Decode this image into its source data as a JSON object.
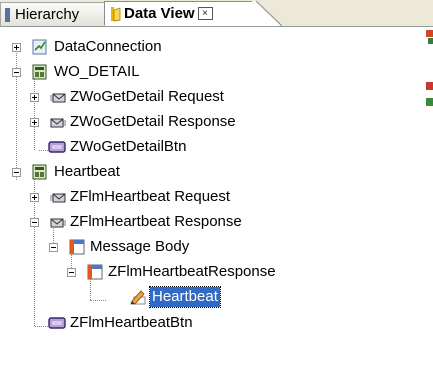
{
  "tabs": [
    {
      "label": "Hierarchy",
      "active": false
    },
    {
      "label": "Data View",
      "active": true
    }
  ],
  "tree": {
    "nodes": [
      {
        "label": "DataConnection",
        "icon": "data-connection-icon",
        "expander": "plus"
      },
      {
        "label": "WO_DETAIL",
        "icon": "service-icon",
        "expander": "minus"
      },
      {
        "label": "ZWoGetDetail Request",
        "icon": "request-envelope-icon",
        "expander": "plus"
      },
      {
        "label": "ZWoGetDetail Response",
        "icon": "response-envelope-icon",
        "expander": "plus"
      },
      {
        "label": "ZWoGetDetailBtn",
        "icon": "button-icon",
        "expander": "none"
      },
      {
        "label": "Heartbeat",
        "icon": "service-icon",
        "expander": "minus"
      },
      {
        "label": "ZFlmHeartbeat Request",
        "icon": "request-envelope-icon",
        "expander": "plus"
      },
      {
        "label": "ZFlmHeartbeat Response",
        "icon": "response-envelope-icon",
        "expander": "minus"
      },
      {
        "label": "Message Body",
        "icon": "message-body-icon",
        "expander": "minus"
      },
      {
        "label": "ZFlmHeartbeatResponse",
        "icon": "structure-icon",
        "expander": "minus"
      },
      {
        "label": "Heartbeat",
        "icon": "field-pencil-icon",
        "expander": "none",
        "selected": true
      },
      {
        "label": "ZFlmHeartbeatBtn",
        "icon": "button-icon",
        "expander": "none"
      }
    ]
  },
  "colors": {
    "selection": "#316ac5",
    "tab_bar": "#ece9d8"
  }
}
